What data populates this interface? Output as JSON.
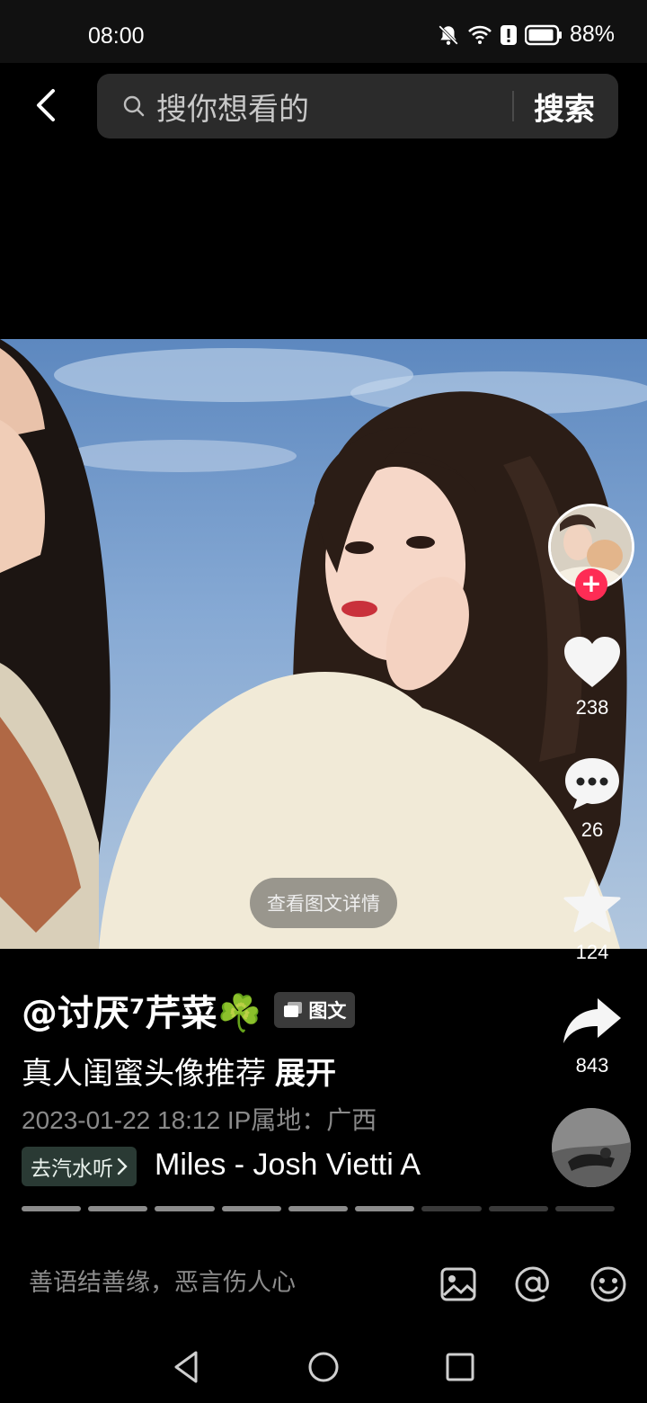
{
  "status_bar": {
    "time": "08:00",
    "battery": "88%"
  },
  "search": {
    "placeholder": "搜你想看的",
    "button": "搜索"
  },
  "photo": {
    "detail_button": "查看图文详情"
  },
  "actions": {
    "likes": "238",
    "comments": "26",
    "favorites": "124",
    "shares": "843"
  },
  "post": {
    "author": "@讨厌⁷芹菜☘️",
    "type_tag": "图文",
    "caption": "真人闺蜜头像推荐",
    "expand": "展开",
    "meta": "2023-01-22 18:12  IP属地：广西",
    "music_chip": "去汽水听",
    "music": "Miles - Josh Vietti   A"
  },
  "progress": {
    "total": 9,
    "completed": 6
  },
  "comment": {
    "placeholder": "善语结善缘，恶言伤人心"
  },
  "colors": {
    "accent": "#fe2c55",
    "background": "#000000"
  }
}
